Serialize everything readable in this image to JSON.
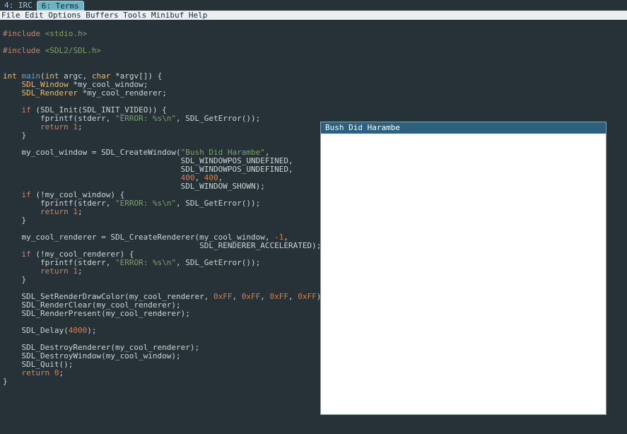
{
  "tabs": {
    "t0": "4: IRC",
    "t1": "6: Terms"
  },
  "menubar": "File Edit Options Buffers Tools Minibuf Help",
  "code": {
    "l01a": "#include ",
    "l01b": "<stdio.h>",
    "l02a": "#include ",
    "l02b": "<SDL2/SDL.h>",
    "l03a": "int",
    "l03b": " ",
    "l03c": "main",
    "l03d": "(",
    "l03e": "int",
    "l03f": " argc, ",
    "l03g": "char",
    "l03h": " *argv[]) {",
    "l04a": "    ",
    "l04b": "SDL_Window",
    "l04c": " *my_cool_window;",
    "l05a": "    ",
    "l05b": "SDL_Renderer",
    "l05c": " *my_cool_renderer;",
    "l06a": "    ",
    "l06b": "if",
    "l06c": " (SDL_Init(SDL_INIT_VIDEO)) {",
    "l07a": "        fprintf(stderr, ",
    "l07b": "\"ERROR: %s\\n\"",
    "l07c": ", SDL_GetError());",
    "l08a": "        ",
    "l08b": "return",
    "l08c": " ",
    "l08d": "1",
    "l08e": ";",
    "l09a": "    }",
    "l10a": "    my_cool_window = SDL_CreateWindow(",
    "l10b": "\"Bush Did Harambe\"",
    "l10c": ",",
    "l11a": "                                      SDL_WINDOWPOS_UNDEFINED,",
    "l12a": "                                      SDL_WINDOWPOS_UNDEFINED,",
    "l13a": "                                      ",
    "l13b": "400",
    "l13c": ", ",
    "l13d": "400",
    "l13e": ",",
    "l14a": "                                      SDL_WINDOW_SHOWN);",
    "l15a": "    ",
    "l15b": "if",
    "l15c": " (!my_cool_window) {",
    "l16a": "        fprintf(stderr, ",
    "l16b": "\"ERROR: %s\\n\"",
    "l16c": ", SDL_GetError());",
    "l17a": "        ",
    "l17b": "return",
    "l17c": " ",
    "l17d": "1",
    "l17e": ";",
    "l18a": "    }",
    "l19a": "    my_cool_renderer = SDL_CreateRenderer(my_cool_window, ",
    "l19b": "-1",
    "l19c": ",",
    "l20a": "                                          SDL_RENDERER_ACCELERATED);",
    "l21a": "    ",
    "l21b": "if",
    "l21c": " (!my_cool_renderer) {",
    "l22a": "        fprintf(stderr, ",
    "l22b": "\"ERROR: %s\\n\"",
    "l22c": ", SDL_GetError());",
    "l23a": "        ",
    "l23b": "return",
    "l23c": " ",
    "l23d": "1",
    "l23e": ";",
    "l24a": "    }",
    "l25a": "    SDL_SetRenderDrawColor(my_cool_renderer, ",
    "l25b": "0xFF",
    "l25c": ", ",
    "l25d": "0xFF",
    "l25e": ", ",
    "l25f": "0xFF",
    "l25g": ", ",
    "l25h": "0xFF",
    "l25i": ");",
    "l26a": "    SDL_RenderClear(my_cool_renderer);",
    "l27a": "    SDL_RenderPresent(my_cool_renderer);",
    "l28a": "    SDL_Delay(",
    "l28b": "4000",
    "l28c": ");",
    "l29a": "    SDL_DestroyRenderer(my_cool_renderer);",
    "l30a": "    SDL_DestroyWindow(my_cool_window);",
    "l31a": "    SDL_Quit();",
    "l32a": "    ",
    "l32b": "return",
    "l32c": " ",
    "l32d": "0",
    "l32e": ";",
    "l33a": "}"
  },
  "sdl_window_title": "Bush Did Harambe"
}
